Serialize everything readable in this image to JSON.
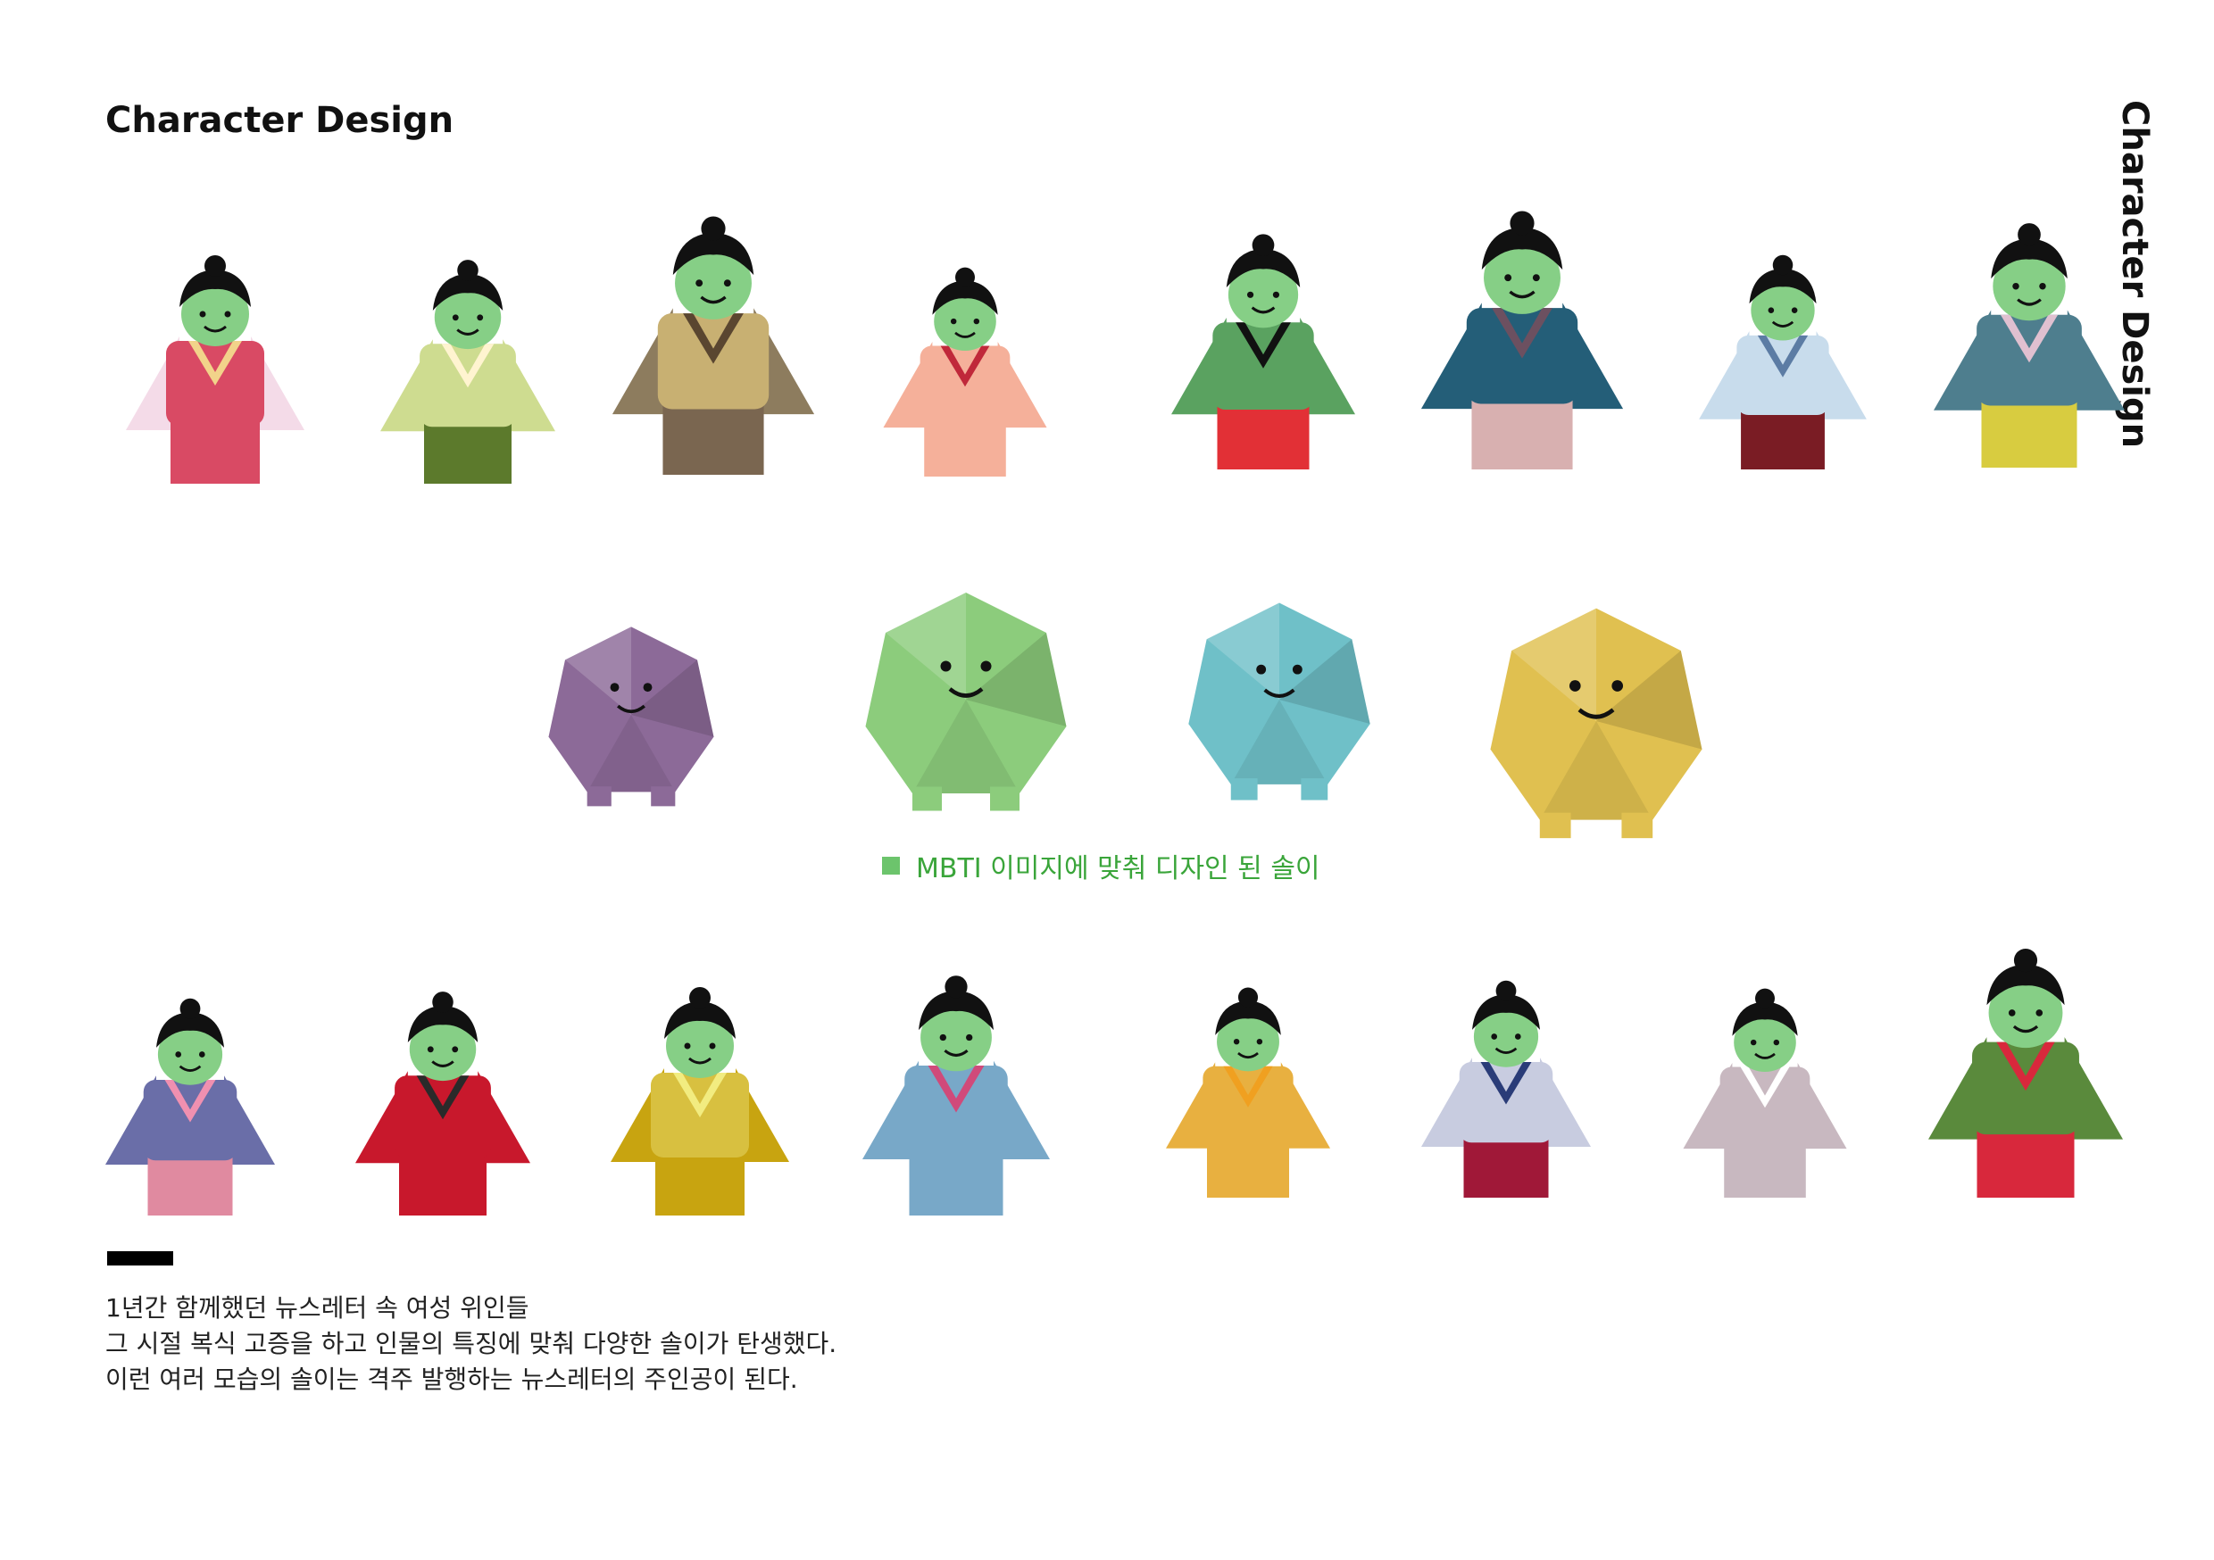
{
  "header": {
    "title": "Character Design",
    "side_title": "Character Design"
  },
  "caption": {
    "text": "MBTI 이미지에 맞춰 디자인 된 솔이",
    "color": "#3aa53a"
  },
  "description": {
    "lines": [
      "1년간 함께했던 뉴스레터 속 여성 위인들",
      "그 시절 복식 고증을 하고 인물의 특징에 맞춰 다양한 솔이가 탄생했다.",
      "이런 여러 모습의 솔이는 격주 발행하는 뉴스레터의 주인공이 된다."
    ]
  },
  "colors": {
    "skin": "#86cf86",
    "hair": "#111111",
    "caption_square": "#6cc46c"
  },
  "characters": {
    "row1": [
      {
        "name": "pink-robe-character",
        "top": "#d94a64",
        "bottom": "#d94a64",
        "sleeve": "#f4dbe8",
        "collar": "#f2d38a"
      },
      {
        "name": "lime-hanbok-character",
        "top": "#cedc90",
        "bottom": "#5c7a2c",
        "sleeve": "#cedc90",
        "collar": "#fff4d0"
      },
      {
        "name": "tan-robe-character",
        "top": "#c8b072",
        "bottom": "#7a6650",
        "sleeve": "#8d7c5e",
        "collar": "#5a4630"
      },
      {
        "name": "peach-kimono-character",
        "top": "#f5b09a",
        "bottom": "#f5b09a",
        "sleeve": "#f5b09a",
        "collar": "#c0283a"
      },
      {
        "name": "green-jeogori-character",
        "top": "#5aa260",
        "bottom": "#e23036",
        "sleeve": "#5aa260",
        "collar": "#111111"
      },
      {
        "name": "teal-cloak-character",
        "top": "#245e78",
        "bottom": "#d8b0b0",
        "sleeve": "#245e78",
        "collar": "#6c5060"
      },
      {
        "name": "scholar-brush-character",
        "top": "#c8dcec",
        "bottom": "#7a1c24",
        "sleeve": "#c8dcec",
        "collar": "#5c7ca4"
      },
      {
        "name": "royal-headdress-character",
        "top": "#4e7e8e",
        "bottom": "#d8cc40",
        "sleeve": "#4e7e8e",
        "collar": "#e0c0d0"
      }
    ],
    "mbti": [
      {
        "name": "purple-podium-character",
        "color": "#8c6a98"
      },
      {
        "name": "green-pinwheel-character",
        "color": "#8ccc7c"
      },
      {
        "name": "blue-cake-character",
        "color": "#6fc0c8"
      },
      {
        "name": "gold-maraca-character",
        "color": "#e0c050"
      }
    ],
    "row2": [
      {
        "name": "brown-hair-lilac-character",
        "top": "#6a6ea8",
        "bottom": "#e08aa0",
        "sleeve": "#6a6ea8",
        "collar": "#f090b0"
      },
      {
        "name": "crowned-red-robe-character",
        "top": "#c8182c",
        "bottom": "#c8182c",
        "sleeve": "#c8182c",
        "collar": "#2a2a2a"
      },
      {
        "name": "golden-crown-character",
        "top": "#d8c040",
        "bottom": "#c8a410",
        "sleeve": "#c8a410",
        "collar": "#f2ec80"
      },
      {
        "name": "blue-shawl-character",
        "top": "#78a8c8",
        "bottom": "#78a8c8",
        "sleeve": "#78a8c8",
        "collar": "#d04a7a"
      },
      {
        "name": "amber-robe-character",
        "top": "#e8b040",
        "bottom": "#e8b040",
        "sleeve": "#e8b040",
        "collar": "#f0a020"
      },
      {
        "name": "navy-crimson-character",
        "top": "#c8cce0",
        "bottom": "#a01838",
        "sleeve": "#c8cce0",
        "collar": "#2a3c78"
      },
      {
        "name": "grey-coat-character",
        "top": "#c8b8c0",
        "bottom": "#c8b8c0",
        "sleeve": "#c8b8c0",
        "collar": "#ffffff"
      },
      {
        "name": "bridal-green-character",
        "top": "#5a8a3c",
        "bottom": "#d8283c",
        "sleeve": "#5a8a3c",
        "collar": "#d8283c"
      }
    ]
  }
}
